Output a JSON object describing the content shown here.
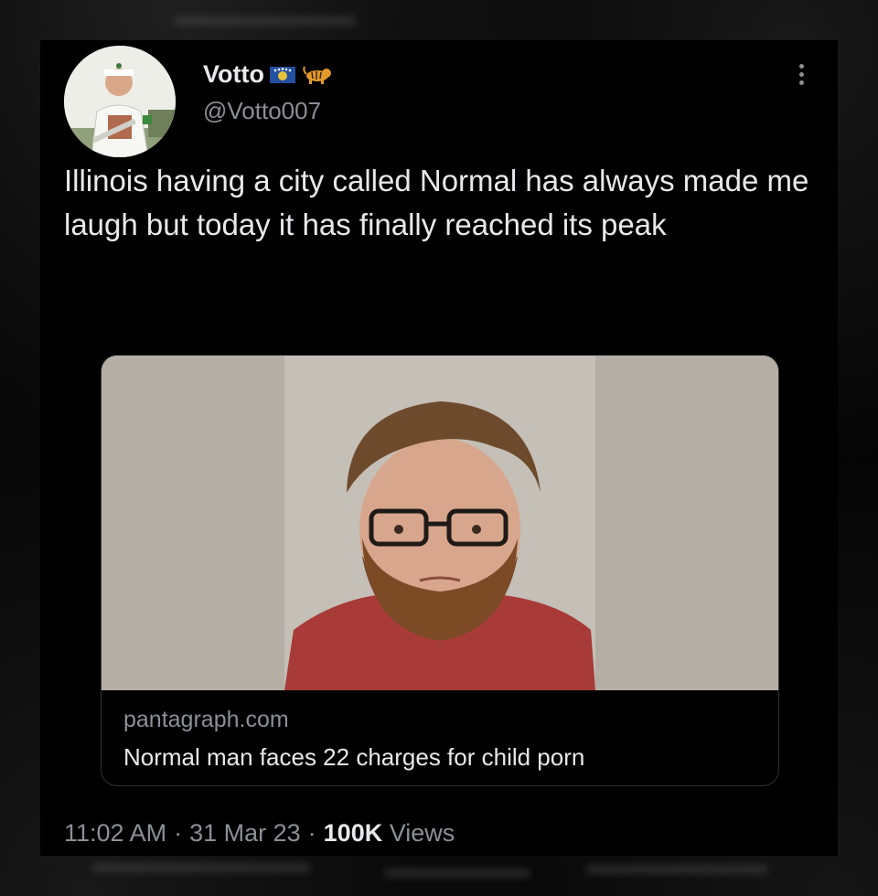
{
  "tweet": {
    "display_name": "Votto",
    "handle": "@Votto007",
    "badges": [
      "flag-icon",
      "tiger-icon"
    ],
    "text": "Illinois having a city called Normal has always made me laugh but today it has finally reached its peak",
    "card": {
      "domain": "pantagraph.com",
      "title": "Normal man faces 22 charges for child porn"
    },
    "time": "11:02 AM",
    "date": "31 Mar 23",
    "separator": "·",
    "views_count": "100K",
    "views_label": "Views"
  },
  "colors": {
    "background": "#000000",
    "primary_text": "#e7e9ea",
    "secondary_text": "#8b9097",
    "card_border": "#2f3336"
  }
}
